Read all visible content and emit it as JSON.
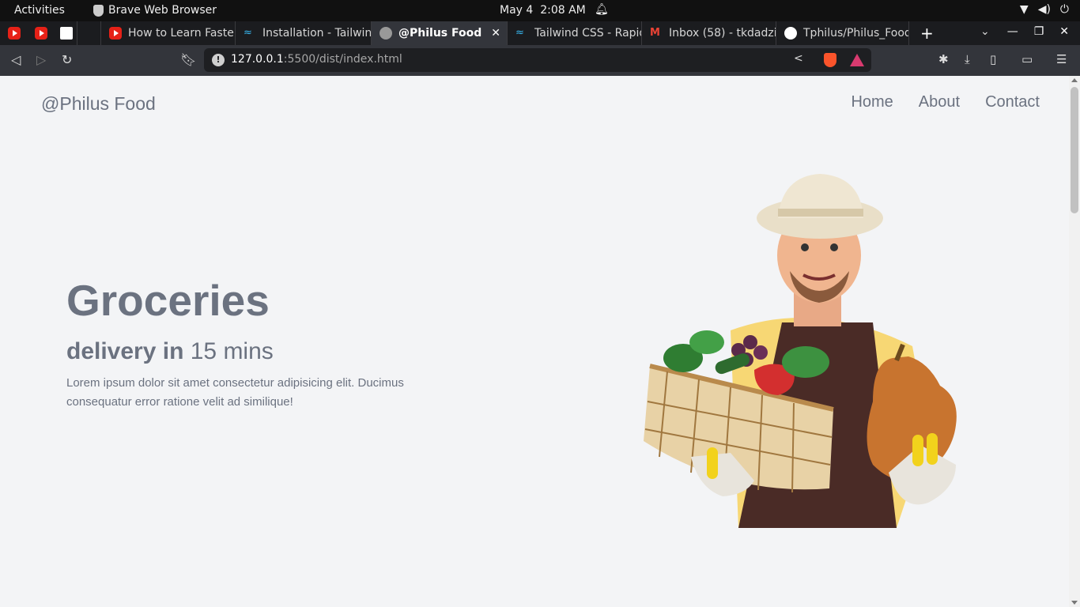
{
  "system": {
    "activities": "Activities",
    "app_name": "Brave Web Browser",
    "date": "May 4",
    "time": "2:08 AM"
  },
  "tabs": [
    {
      "label": "",
      "icon": "youtube-icon"
    },
    {
      "label": "",
      "icon": "youtube-icon"
    },
    {
      "label": "",
      "icon": "document-icon"
    },
    {
      "label": "How to Learn Faster",
      "icon": "youtube-icon"
    },
    {
      "label": "Installation - Tailwind",
      "icon": "tailwind-icon"
    },
    {
      "label": "@Philus Food",
      "icon": "globe-icon",
      "active": true
    },
    {
      "label": "Tailwind CSS - Rapid",
      "icon": "tailwind-icon"
    },
    {
      "label": "Inbox (58) - tkdadzie",
      "icon": "gmail-icon"
    },
    {
      "label": "Tphilus/Philus_Food",
      "icon": "github-icon"
    }
  ],
  "toolbar": {
    "url_host": "127.0.0.1",
    "url_path": ":5500/dist/index.html"
  },
  "site": {
    "brand": "@Philus Food",
    "nav": [
      "Home",
      "About",
      "Contact"
    ],
    "hero_title": "Groceries",
    "hero_sub_bold": "delivery in",
    "hero_sub_rest": " 15 mins",
    "hero_text": "Lorem ipsum dolor sit amet consectetur adipisicing elit. Ducimus consequatur error ratione velit ad similique!"
  }
}
